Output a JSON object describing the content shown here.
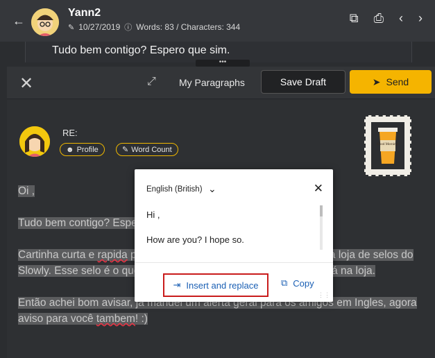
{
  "header": {
    "name": "Yann2",
    "date": "10/27/2019",
    "stats": "Words: 83 / Characters: 344"
  },
  "letter_preview": "Tudo bem contigo? Espero que sim.",
  "handle_dots": "•••",
  "toolbar": {
    "paragraphs_label": "My Paragraphs",
    "save_label": "Save Draft",
    "send_label": "Send"
  },
  "compose": {
    "re_label": "RE:",
    "profile_label": "Profile",
    "wordcount_label": "Word Count",
    "stamp_text": "Good Morning!"
  },
  "body": {
    "p1": "Oi                    ,",
    "p2": "Tudo bem contigo? Espero que sim.",
    "p3a": "Cartinha curta e ",
    "p3b": "rapida",
    "p3c": " para lhe avisar de um novo selo, Gratis, na loja de selos do Slowly. Esse selo é o que está aqui nesta carta, e pode ser pego lá na loja.",
    "p4a": "Então achei bom avisar, já mandei um alerta geral para os amigos em Ingles, agora aviso para você ",
    "p4b": "tambem",
    "p4c": "! :)"
  },
  "translator": {
    "language": "English (British)",
    "line1": "Hi                    ,",
    "line2": "How are you? I hope so.",
    "insert_label": "Insert and replace",
    "copy_label": "Copy"
  },
  "colors": {
    "accent": "#f5b400",
    "popup_link": "#1a5fb4",
    "highlight_box": "#c91b1b"
  }
}
